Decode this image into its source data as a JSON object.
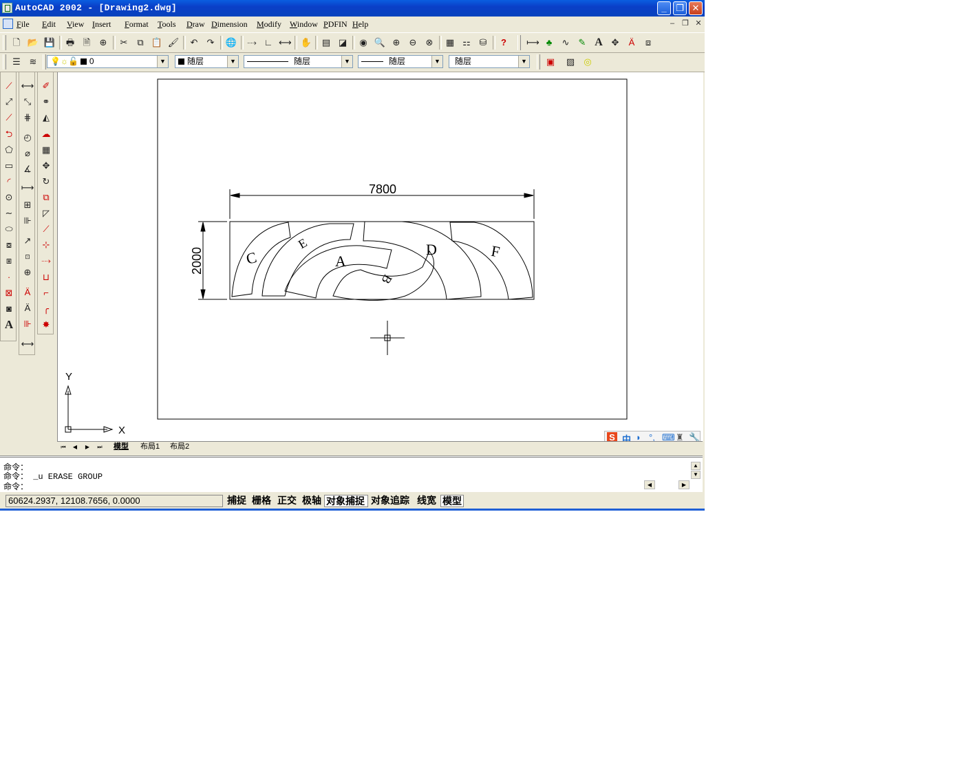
{
  "window": {
    "title": "AutoCAD 2002 - [Drawing2.dwg]"
  },
  "menu": [
    "File",
    "Edit",
    "View",
    "Insert",
    "Format",
    "Tools",
    "Draw",
    "Dimension",
    "Modify",
    "Window",
    "PDFIN",
    "Help"
  ],
  "layer_combo": "0",
  "color_combo": "随层",
  "linetype_combo": "随层",
  "lineweight_combo": "随层",
  "plotstyle_combo": "随层",
  "drawing": {
    "dim_width": "7800",
    "dim_height": "2000",
    "labels": {
      "a": "A",
      "b": "B",
      "c": "C",
      "d": "D",
      "e": "E",
      "f": "F"
    },
    "ucs_x": "X",
    "ucs_y": "Y"
  },
  "tabs": [
    "模型",
    "布局1",
    "布局2"
  ],
  "ime": {
    "brand": "S",
    "mode": "中"
  },
  "command": {
    "line1": "命令：",
    "line2": "命令： _u ERASE GROUP",
    "line3": "命令："
  },
  "status": {
    "coords": "60624.2937, 12108.7656, 0.0000",
    "buttons": [
      "捕捉",
      "栅格",
      "正交",
      "极轴",
      "对象捕捉",
      "对象追踪",
      "线宽",
      "模型"
    ]
  }
}
